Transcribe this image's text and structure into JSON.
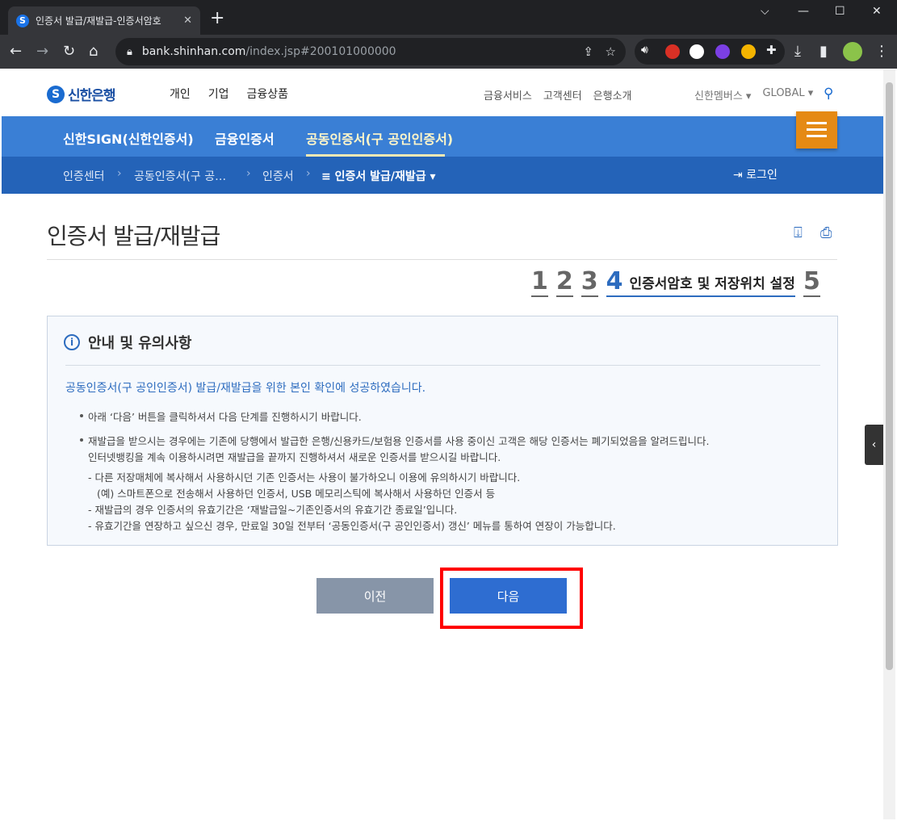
{
  "browser": {
    "tab_title": "인증서 발급/재발급-인증서암호",
    "tab_close": "✕",
    "new_tab": "+",
    "url_host": "bank.shinhan.com",
    "url_path": "/index.jsp#200101000000",
    "window_controls": [
      "⌵",
      "—",
      "☐",
      "✕"
    ]
  },
  "site": {
    "logo_text": "신한은행",
    "logo_mark": "S",
    "gnb_main": [
      "개인",
      "기업",
      "금융상품"
    ],
    "gnb_util": [
      "금융서비스",
      "고객센터",
      "은행소개"
    ],
    "gnb_right": [
      "신한멤버스 ▾",
      "GLOBAL ▾"
    ],
    "menu": [
      "신한SIGN(신한인증서)",
      "금융인증서",
      "공동인증서(구 공인인증서)"
    ],
    "breadcrumb": [
      "인증센터",
      "공동인증서(구 공…",
      "인증서",
      "≡ 인증서 발급/재발급 ▾"
    ],
    "login": "로그인"
  },
  "page": {
    "title": "인증서 발급/재발급",
    "steps": [
      "1",
      "2",
      "3",
      "4",
      "5"
    ],
    "current_step_label": "인증서암호 및 저장위치 설정"
  },
  "notice": {
    "title": "안내 및 유의사항",
    "lead": "공동인증서(구 공인인증서) 발급/재발급을 위한 본인 확인에 성공하였습니다.",
    "item1": "아래 ‘다음’ 버튼을 클릭하셔서 다음 단계를 진행하시기 바랍니다.",
    "item2_line1": "재발급을 받으시는 경우에는 기존에 당행에서 발급한 은행/신용카드/보험용 인증서를 사용 중이신 고객은 해당 인증서는 폐기되었음을 알려드립니다.",
    "item2_line2": "인터넷뱅킹을 계속 이용하시려면 재발급을 끝까지 진행하셔서 새로운 인증서를 받으시길 바랍니다.",
    "sub1_line1": "- 다른 저장매체에 복사해서 사용하시던 기존 인증서는 사용이 불가하오니 이용에 유의하시기 바랍니다.",
    "sub1_line2": "(예) 스마트폰으로 전송해서 사용하던 인증서, USB 메모리스틱에 복사해서 사용하던 인증서 등",
    "sub2": "- 재발급의 경우 인증서의 유효기간은 ‘재발급일~기존인증서의 유효기간 종료일’입니다.",
    "sub3": "- 유효기간을 연장하고 싶으신 경우, 만료일 30일 전부터 ‘공동인증서(구 공인인증서) 갱신’ 메뉴를 통하여 연장이 가능합니다."
  },
  "buttons": {
    "prev": "이전",
    "next": "다음"
  },
  "side_tab": "‹",
  "colors": {
    "menu_bar": "#3a7fd5",
    "sub_bar": "#2463b8",
    "hamburger": "#e58a14",
    "next_button": "#2e6dd1",
    "prev_button": "#8795a8",
    "highlight_box": "#ff0000"
  }
}
